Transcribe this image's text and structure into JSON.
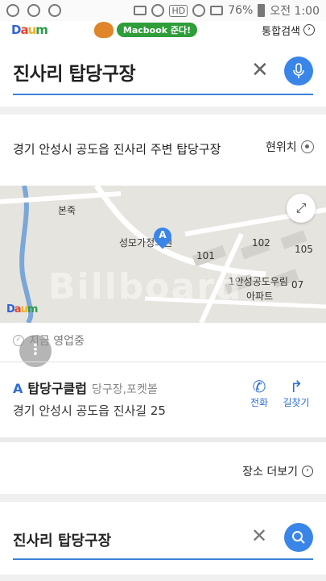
{
  "status_bar": {
    "battery": "76%",
    "time": "오전 1:00",
    "hd": "HD"
  },
  "header": {
    "logo": [
      "D",
      "a",
      "u",
      "m"
    ],
    "ad_text": "Macbook 준다!",
    "integrated_search": "통합검색"
  },
  "search": {
    "query": "진사리 탑당구장"
  },
  "result": {
    "area_title": "경기 안성시 공도읍 진사리 주변 탑당구장",
    "current_location": "현위치",
    "map_labels": {
      "l1": "본죽",
      "l2": "성모가정의원",
      "l3": "102",
      "l4": "105",
      "l5": "101",
      "l6": "1안성공도우림",
      "l7": "아파트",
      "l8": "07"
    },
    "pin_letter": "A",
    "map_logo": "Daum",
    "open_status": "지금 영업중",
    "place_letter": "A",
    "place_name": "탑당구클럽",
    "place_category": "당구장,포켓볼",
    "place_address": "경기 안성시 공도읍 진사길 25",
    "call_label": "전화",
    "route_label": "길찾기",
    "more_places": "장소 더보기"
  },
  "watermark": "Billboard",
  "colors": {
    "accent": "#3a86e8",
    "link": "#2f6fd6"
  }
}
